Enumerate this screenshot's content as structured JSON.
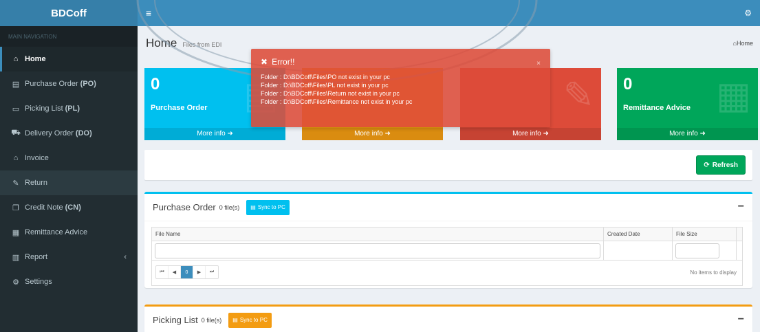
{
  "app": {
    "logo_bold": "BDC",
    "logo_rest": "off"
  },
  "sidebar": {
    "header": "MAIN NAVIGATION",
    "items": [
      {
        "icon": "home-icon",
        "glyph": "⌂",
        "label": "Home",
        "abbr": ""
      },
      {
        "icon": "document-icon",
        "glyph": "▤",
        "label": "Purchase Order",
        "abbr": "(PO)"
      },
      {
        "icon": "list-icon",
        "glyph": "▭",
        "label": "Picking List",
        "abbr": "(PL)"
      },
      {
        "icon": "truck-icon",
        "glyph": "⛟",
        "label": "Delivery Order",
        "abbr": "(DO)"
      },
      {
        "icon": "bank-icon",
        "glyph": "⌂",
        "label": "Invoice",
        "abbr": ""
      },
      {
        "icon": "edit-icon",
        "glyph": "✎",
        "label": "Return",
        "abbr": ""
      },
      {
        "icon": "copy-icon",
        "glyph": "❐",
        "label": "Credit Note",
        "abbr": "(CN)"
      },
      {
        "icon": "calendar-icon",
        "glyph": "▦",
        "label": "Remittance Advice",
        "abbr": ""
      },
      {
        "icon": "bar-chart-icon",
        "glyph": "▥",
        "label": "Report",
        "abbr": ""
      },
      {
        "icon": "gears-icon",
        "glyph": "⚙",
        "label": "Settings",
        "abbr": ""
      }
    ]
  },
  "page": {
    "title": "Home",
    "subtitle": "Files from EDI",
    "breadcrumb": "Home"
  },
  "tiles": [
    {
      "count": "0",
      "label": "Purchase Order",
      "more": "More info"
    },
    {
      "count": "",
      "label": "",
      "more": "More info"
    },
    {
      "count": "",
      "label": "",
      "more": "More info"
    },
    {
      "count": "0",
      "label": "Remittance Advice",
      "more": "More info"
    }
  ],
  "refresh_label": "Refresh",
  "panels": {
    "po": {
      "title": "Purchase Order",
      "count": "0 file(s)",
      "sync": "Sync to PC"
    },
    "pl": {
      "title": "Picking List",
      "count": "0 file(s)",
      "sync": "Sync to PC"
    }
  },
  "grid": {
    "columns": [
      "File Name",
      "Created Date",
      "File Size"
    ],
    "page": "0",
    "empty": "No items to display"
  },
  "error": {
    "title": "Error!!",
    "lines": [
      "Folder : D:\\BDCoff\\Files\\PO not exist in your pc",
      "Folder : D:\\BDCoff\\Files\\PL not exist in your pc",
      "Folder : D:\\BDCoff\\Files\\Return not exist in your pc",
      "Folder : D:\\BDCoff\\Files\\Remittance not exist in your pc"
    ],
    "close": "×"
  },
  "colors": {
    "sidebar": "#222d32",
    "topbar": "#3c8dbc",
    "aqua": "#00c0ef",
    "yellow": "#f39c12",
    "red": "#dd4b39",
    "green": "#00a65a"
  }
}
